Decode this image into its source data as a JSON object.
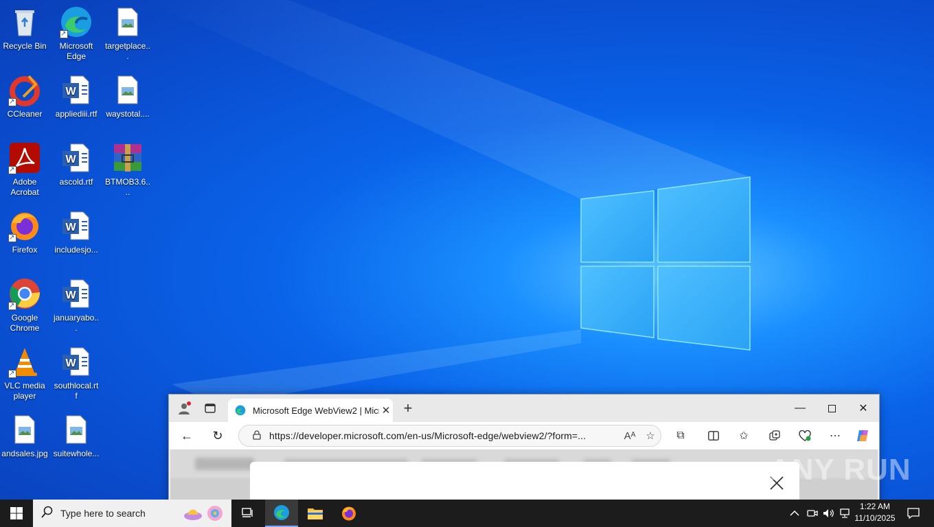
{
  "desktop": {
    "icons": [
      {
        "label": "Recycle Bin",
        "icon": "recycle-bin-icon"
      },
      {
        "label": "Microsoft Edge",
        "icon": "edge-icon"
      },
      {
        "label": "targetplace...",
        "icon": "image-file-icon"
      },
      {
        "label": "CCleaner",
        "icon": "ccleaner-icon"
      },
      {
        "label": "appliediii.rtf",
        "icon": "word-doc-icon"
      },
      {
        "label": "waystotal....",
        "icon": "image-file-icon"
      },
      {
        "label": "Adobe Acrobat",
        "icon": "acrobat-icon"
      },
      {
        "label": "ascold.rtf",
        "icon": "word-doc-icon"
      },
      {
        "label": "BTMOB3.6....",
        "icon": "winrar-icon"
      },
      {
        "label": "Firefox",
        "icon": "firefox-icon"
      },
      {
        "label": "includesjo...",
        "icon": "word-doc-icon"
      },
      {
        "label": "Google Chrome",
        "icon": "chrome-icon"
      },
      {
        "label": "januaryabo...",
        "icon": "word-doc-icon"
      },
      {
        "label": "VLC media player",
        "icon": "vlc-icon"
      },
      {
        "label": "southlocal.rtf",
        "icon": "word-doc-icon"
      },
      {
        "label": "andsales.jpg",
        "icon": "image-file-icon"
      },
      {
        "label": "suitewhole...",
        "icon": "image-file-icon"
      }
    ]
  },
  "browser": {
    "tab_title": "Microsoft Edge WebView2 | Micro",
    "url": "https://developer.microsoft.com/en-us/Microsoft-edge/webview2/?form=...",
    "read_aloud_glyph": "Aᴬ"
  },
  "watermark": "ANY RUN",
  "taskbar": {
    "search_placeholder": "Type here to search",
    "time": "1:22 AM",
    "date": "11/10/2025"
  },
  "colors": {
    "taskbar": "#1c1c1c",
    "desktop_blue": "#0a63e8",
    "edge_accent": "#0f8fd8"
  }
}
